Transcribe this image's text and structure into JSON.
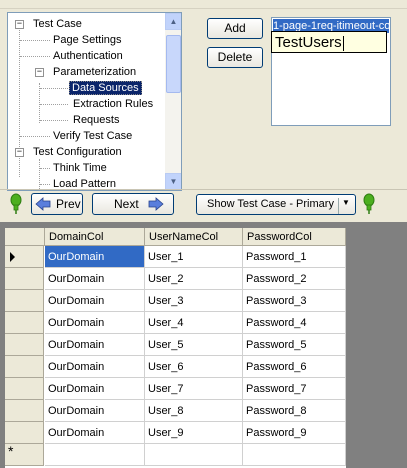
{
  "tree": {
    "nodes": [
      {
        "label": "Test Case",
        "expander": "−"
      },
      {
        "label": "Page Settings"
      },
      {
        "label": "Authentication"
      },
      {
        "label": "Parameterization",
        "expander": "−"
      },
      {
        "label": "Data Sources",
        "selected": true
      },
      {
        "label": "Extraction Rules"
      },
      {
        "label": "Requests"
      },
      {
        "label": "Verify Test Case"
      },
      {
        "label": "Test Configuration",
        "expander": "−"
      },
      {
        "label": "Think Time"
      },
      {
        "label": "Load Pattern"
      }
    ]
  },
  "buttons": {
    "add": "Add",
    "delete": "Delete",
    "prev": "Prev",
    "next": "Next",
    "show": "Show Test Case - Primary"
  },
  "datasource_list": {
    "selected_item": "1-page-1req-itimeout-co",
    "edit_value": "TestUsers"
  },
  "grid": {
    "columns": [
      "DomainCol",
      "UserNameCol",
      "PasswordCol"
    ],
    "rows": [
      [
        "OurDomain",
        "User_1",
        "Password_1"
      ],
      [
        "OurDomain",
        "User_2",
        "Password_2"
      ],
      [
        "OurDomain",
        "User_3",
        "Password_3"
      ],
      [
        "OurDomain",
        "User_4",
        "Password_4"
      ],
      [
        "OurDomain",
        "User_5",
        "Password_5"
      ],
      [
        "OurDomain",
        "User_6",
        "Password_6"
      ],
      [
        "OurDomain",
        "User_7",
        "Password_7"
      ],
      [
        "OurDomain",
        "User_8",
        "Password_8"
      ],
      [
        "OurDomain",
        "User_9",
        "Password_9"
      ]
    ],
    "new_row_marker": "*"
  },
  "colors": {
    "panel": "#ece9d8",
    "selection": "#316ac5",
    "bulb": "#4caf1f"
  }
}
